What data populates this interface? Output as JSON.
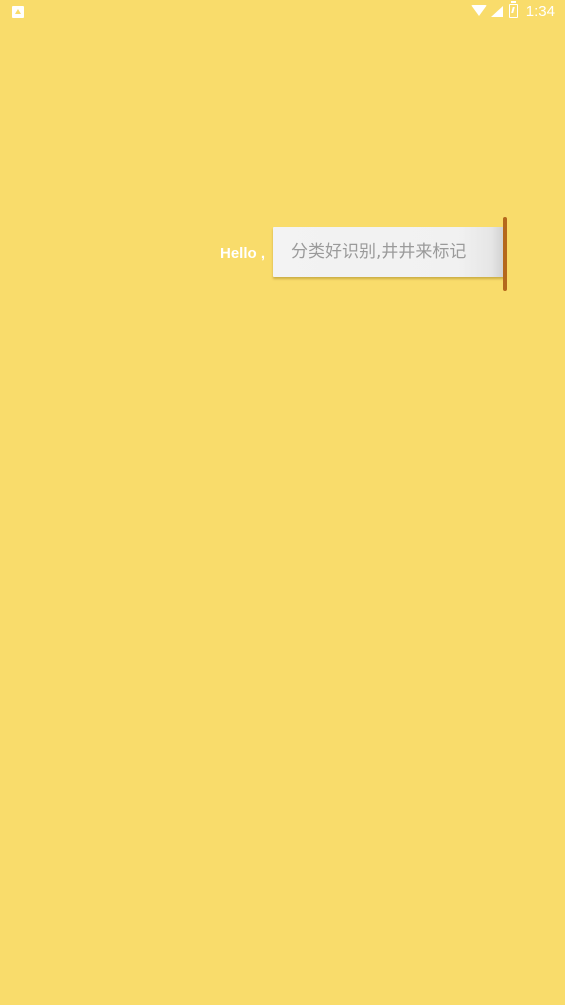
{
  "status_bar": {
    "time": "1:34",
    "icons": [
      "notification-icon",
      "wifi-icon",
      "signal-icon",
      "battery-charging-icon"
    ]
  },
  "splash": {
    "greeting": "Hello ,",
    "slogan": "分类好识别,井井来标记"
  },
  "colors": {
    "background": "#f9dc6b",
    "paper": "#f1f1f1",
    "rod": "#b5681c",
    "greeting_text": "#ffffff",
    "slogan_text": "#9a9a9a"
  }
}
